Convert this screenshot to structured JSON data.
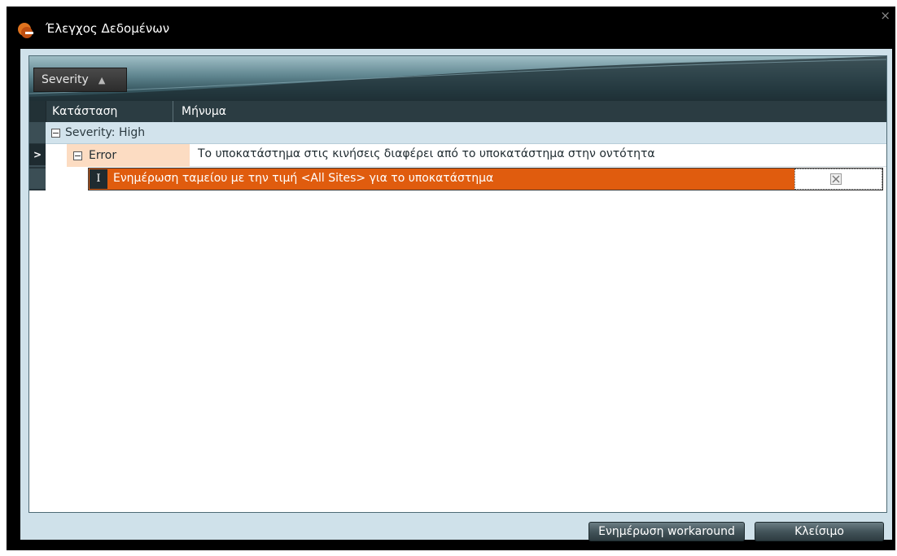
{
  "window": {
    "title": "Έλεγχος Δεδομένων",
    "logo_icon": "app-logo-icon",
    "close_glyph": "×"
  },
  "group_panel": {
    "chip_label": "Severity",
    "sort_glyph": "▲"
  },
  "columns": {
    "status": "Κατάσταση",
    "message": "Μήνυμα"
  },
  "rows": {
    "group_label": "Severity: High",
    "selector_glyph": ">",
    "error": {
      "status": "Error",
      "message": "Το υποκατάστημα στις κινήσεις διαφέρει από το υποκατάστημα στην οντότητα"
    },
    "workaround": {
      "cursor_glyph": "I",
      "text": "Ενημέρωση ταμείου με την τιμή <All Sites> για το υποκατάστημα"
    }
  },
  "buttons": {
    "update_workaround": "Ενημέρωση workaround",
    "close": "Κλείσιμο"
  },
  "colors": {
    "accent_orange": "#e05c0e",
    "status_cell": "#fcdcc2",
    "group_row": "#d2e3ec",
    "dialog_bg": "#cfe1ea"
  }
}
